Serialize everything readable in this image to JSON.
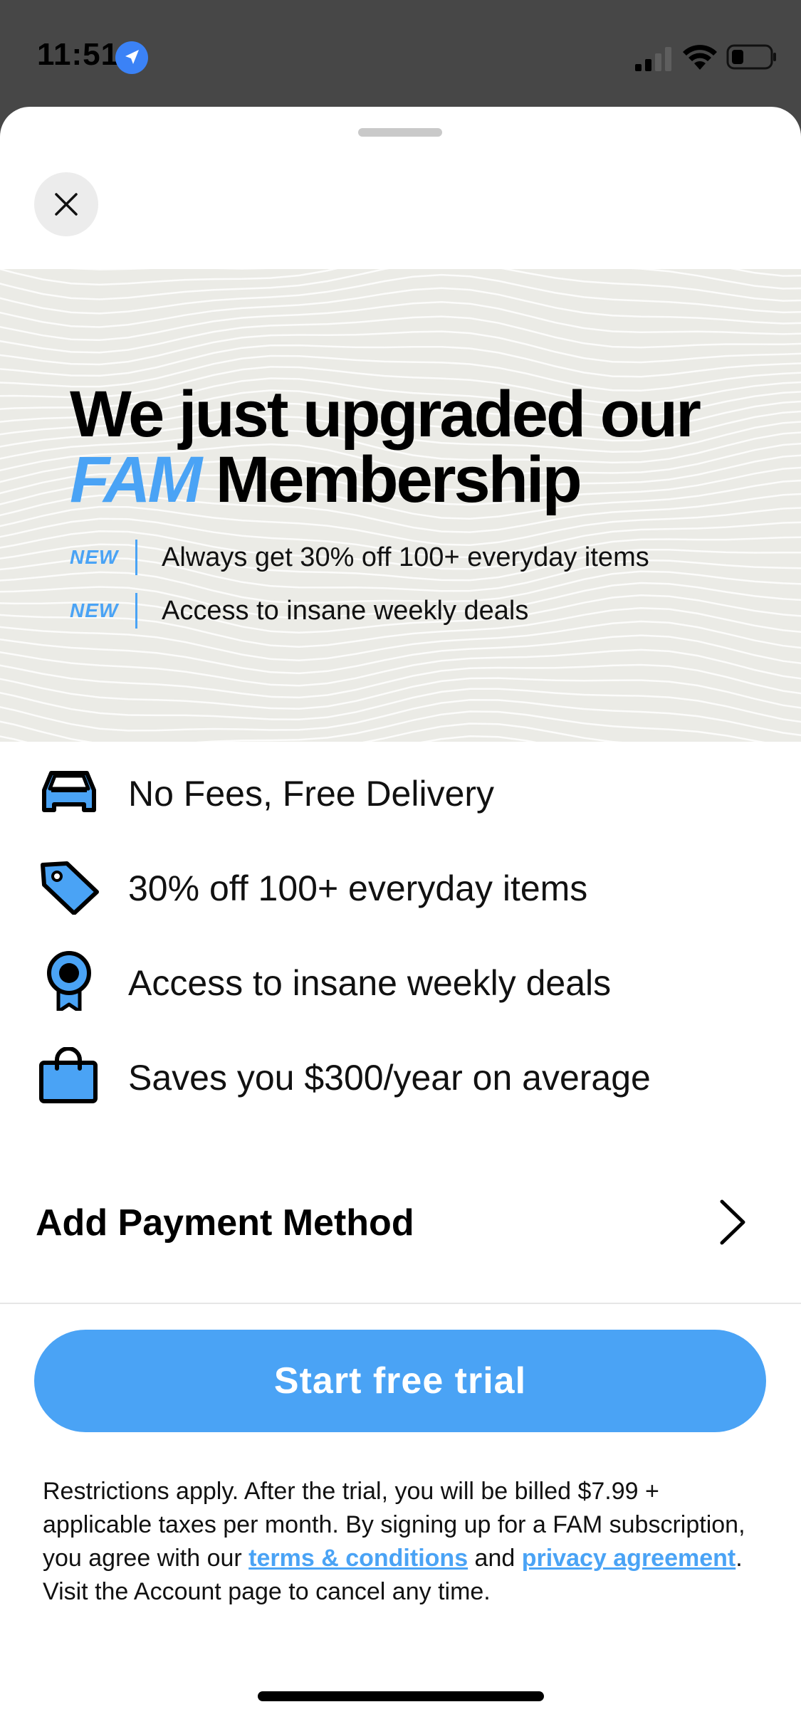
{
  "status_bar": {
    "time": "11:51"
  },
  "hero": {
    "title_line1": "We just upgraded our",
    "title_fam": "FAM",
    "title_line2_rest": "Membership",
    "features": [
      {
        "tag": "NEW",
        "text": "Always get 30% off 100+ everyday items"
      },
      {
        "tag": "NEW",
        "text": "Access to insane weekly deals"
      }
    ]
  },
  "benefits": [
    {
      "icon": "car-icon",
      "text": "No Fees, Free Delivery"
    },
    {
      "icon": "tag-icon",
      "text": "30% off 100+ everyday items"
    },
    {
      "icon": "award-ribbon-icon",
      "text": "Access to insane weekly deals"
    },
    {
      "icon": "shopping-bag-icon",
      "text": "Saves you $300/year on average"
    }
  ],
  "payment": {
    "label": "Add Payment Method"
  },
  "cta": {
    "label": "Start free trial"
  },
  "legal": {
    "part1": "Restrictions apply. After the trial, you will be billed $7.99 + applicable taxes per month. By signing up for a FAM subscription, you agree with our ",
    "terms_link": "terms & conditions",
    "part2": " and ",
    "privacy_link": "privacy agreement",
    "part3": ". Visit the Account page to cancel any time."
  },
  "colors": {
    "accent": "#4aa3f5",
    "hero_bg": "#ebebe6",
    "icon_fill": "#4aa3f5",
    "status_bar_bg": "#474747"
  }
}
